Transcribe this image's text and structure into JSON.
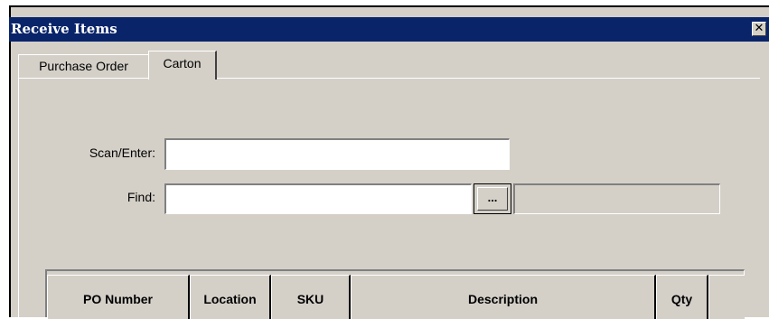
{
  "window": {
    "title": "Receive Items",
    "close_glyph": "✕"
  },
  "tabs": [
    {
      "label": "Purchase Order",
      "selected": false
    },
    {
      "label": "Carton",
      "selected": true
    }
  ],
  "form": {
    "scan_label": "Scan/Enter:",
    "scan_value": "",
    "find_label": "Find:",
    "find_value": "",
    "browse_label": "...",
    "find_display_value": ""
  },
  "grid": {
    "columns": [
      "PO Number",
      "Location",
      "SKU",
      "Description",
      "Qty"
    ]
  }
}
